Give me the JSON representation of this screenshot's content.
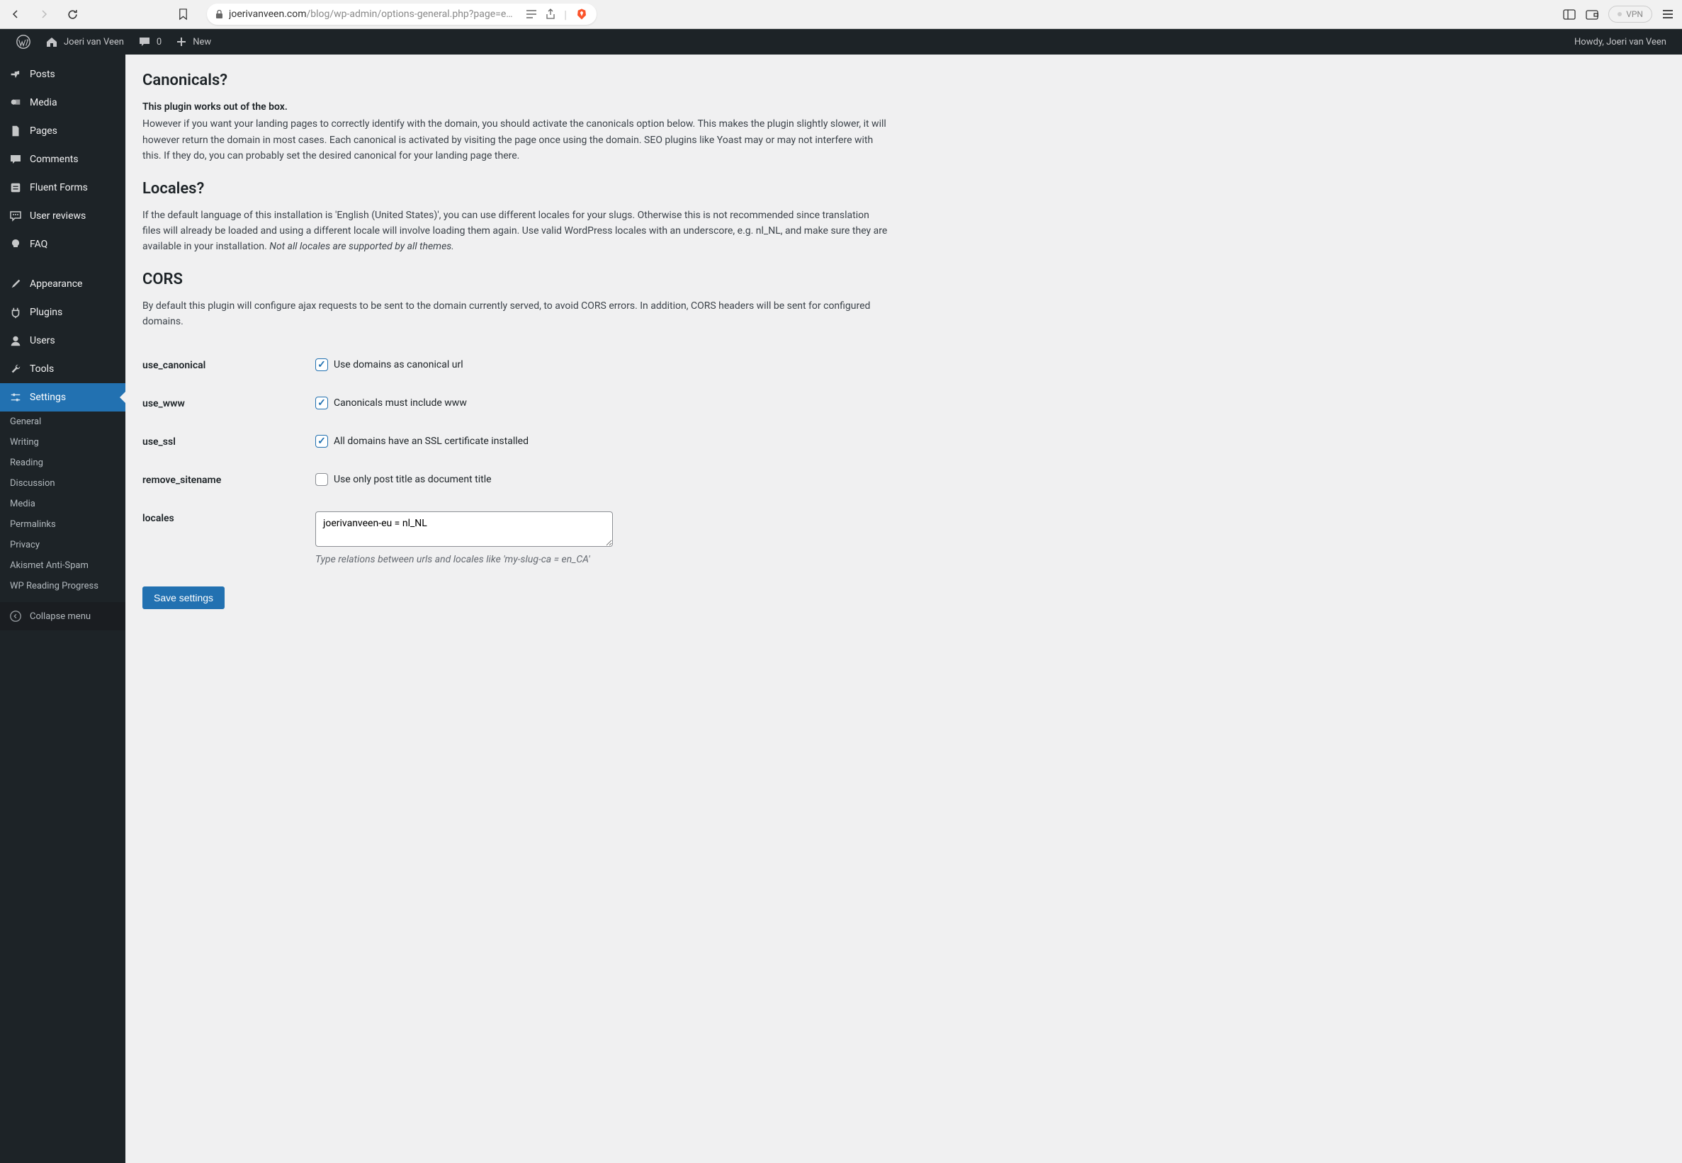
{
  "browser": {
    "url_domain": "joerivanveen.com",
    "url_path": "/blog/wp-admin/options-general.php?page=each-...",
    "vpn_label": "VPN"
  },
  "admin_bar": {
    "site_name": "Joeri van Veen",
    "comments_count": "0",
    "new_label": "New",
    "greeting": "Howdy, Joeri van Veen"
  },
  "sidebar": {
    "items": [
      {
        "label": "Posts"
      },
      {
        "label": "Media"
      },
      {
        "label": "Pages"
      },
      {
        "label": "Comments"
      },
      {
        "label": "Fluent Forms"
      },
      {
        "label": "User reviews"
      },
      {
        "label": "FAQ"
      },
      {
        "label": "Appearance"
      },
      {
        "label": "Plugins"
      },
      {
        "label": "Users"
      },
      {
        "label": "Tools"
      },
      {
        "label": "Settings"
      }
    ],
    "submenu": [
      {
        "label": "General"
      },
      {
        "label": "Writing"
      },
      {
        "label": "Reading"
      },
      {
        "label": "Discussion"
      },
      {
        "label": "Media"
      },
      {
        "label": "Permalinks"
      },
      {
        "label": "Privacy"
      },
      {
        "label": "Akismet Anti-Spam"
      },
      {
        "label": "WP Reading Progress"
      }
    ],
    "collapse_label": "Collapse menu"
  },
  "content": {
    "sections": {
      "canonicals": {
        "heading": "Canonicals?",
        "strong": "This plugin works out of the box.",
        "text": "However if you want your landing pages to correctly identify with the domain, you should activate the canonicals option below. This makes the plugin slightly slower, it will however return the domain in most cases. Each canonical is activated by visiting the page once using the domain. SEO plugins like Yoast may or may not interfere with this. If they do, you can probably set the desired canonical for your landing page there."
      },
      "locales": {
        "heading": "Locales?",
        "text_part1": "If the default language of this installation is 'English (United States)', you can use different locales for your slugs. Otherwise this is not recommended since translation files will already be loaded and using a different locale will involve loading them again. Use valid WordPress locales with an underscore, e.g. nl_NL, and make sure they are available in your installation. ",
        "text_italic": "Not all locales are supported by all themes."
      },
      "cors": {
        "heading": "CORS",
        "text": "By default this plugin will configure ajax requests to be sent to the domain currently served, to avoid CORS errors. In addition, CORS headers will be sent for configured domains."
      }
    },
    "fields": {
      "use_canonical": {
        "label": "use_canonical",
        "checkbox_label": "Use domains as canonical url",
        "checked": true
      },
      "use_www": {
        "label": "use_www",
        "checkbox_label": "Canonicals must include www",
        "checked": true
      },
      "use_ssl": {
        "label": "use_ssl",
        "checkbox_label": "All domains have an SSL certificate installed",
        "checked": true
      },
      "remove_sitename": {
        "label": "remove_sitename",
        "checkbox_label": "Use only post title as document title",
        "checked": false
      },
      "locales": {
        "label": "locales",
        "value": "joerivanveen-eu = nl_NL",
        "description": "Type relations between urls and locales like 'my-slug-ca = en_CA'"
      }
    },
    "save_label": "Save settings"
  }
}
